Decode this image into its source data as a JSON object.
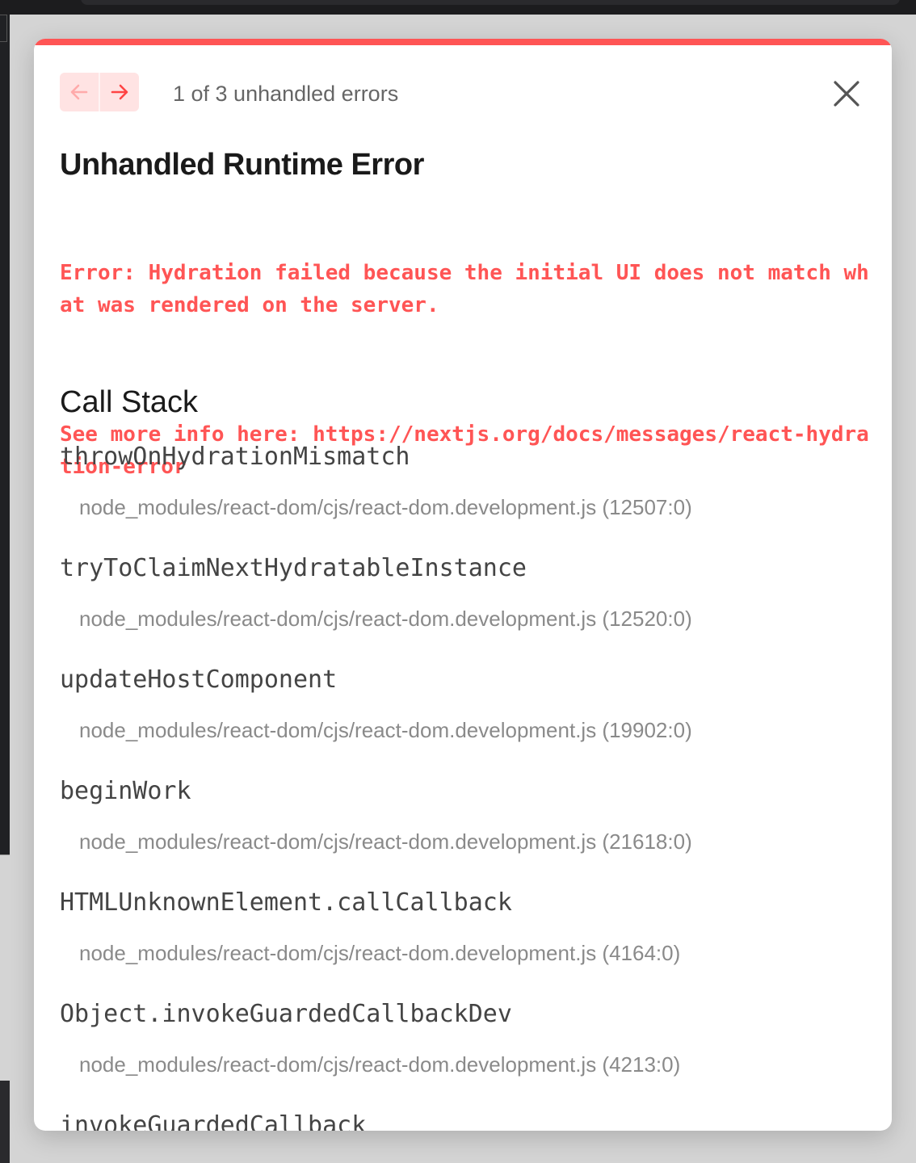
{
  "nav": {
    "prev_icon": "arrow-left-icon",
    "next_icon": "arrow-right-icon",
    "counter": "1 of 3 unhandled errors",
    "close_icon": "close-icon"
  },
  "error": {
    "title": "Unhandled Runtime Error",
    "message_line1": "Error: Hydration failed because the initial UI does not match what was rendered on the server.",
    "message_line2": "See more info here: https://nextjs.org/docs/messages/react-hydration-error"
  },
  "call_stack": {
    "title": "Call Stack",
    "frames": [
      {
        "fn": "throwOnHydrationMismatch",
        "loc": "node_modules/react-dom/cjs/react-dom.development.js (12507:0)"
      },
      {
        "fn": "tryToClaimNextHydratableInstance",
        "loc": "node_modules/react-dom/cjs/react-dom.development.js (12520:0)"
      },
      {
        "fn": "updateHostComponent",
        "loc": "node_modules/react-dom/cjs/react-dom.development.js (19902:0)"
      },
      {
        "fn": "beginWork",
        "loc": "node_modules/react-dom/cjs/react-dom.development.js (21618:0)"
      },
      {
        "fn": "HTMLUnknownElement.callCallback",
        "loc": "node_modules/react-dom/cjs/react-dom.development.js (4164:0)"
      },
      {
        "fn": "Object.invokeGuardedCallbackDev",
        "loc": "node_modules/react-dom/cjs/react-dom.development.js (4213:0)"
      },
      {
        "fn": "invokeGuardedCallback",
        "loc": ""
      }
    ]
  },
  "colors": {
    "accent": "#ff5555",
    "nav_button_bg": "#ffe3e3"
  }
}
